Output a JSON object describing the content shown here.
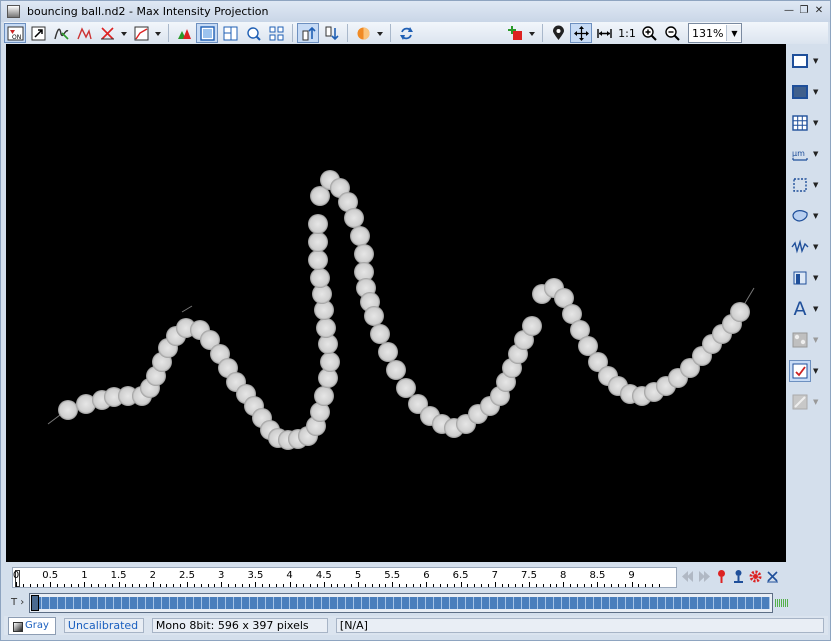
{
  "window": {
    "title": "bouncing ball.nd2 - Max Intensity Projection",
    "controls": [
      "minimize-icon",
      "restore-icon",
      "close-icon"
    ]
  },
  "toolbar": {
    "zoom_value": "131%",
    "one_to_one_label": "1:1",
    "buttons": [
      "lut-on-icon",
      "arrow-select-icon",
      "auto-contrast-icon",
      "histogram-icon",
      "scale-icon",
      "curve-icon",
      "channels-icon",
      "single-view-icon",
      "split-view-icon",
      "zoom-lens-icon",
      "tile-view-icon",
      "up-arrow-icon",
      "down-arrow-icon",
      "color-wheel-icon",
      "refresh-icon",
      "add-object-icon",
      "location-pin-icon",
      "fit-window-icon",
      "fit-width-icon",
      "zoom-in-icon",
      "zoom-out-icon"
    ]
  },
  "sidebar": {
    "items": [
      "rectangle-roi-icon",
      "filled-rectangle-icon",
      "grid-icon",
      "measure-scale-icon",
      "crop-icon",
      "bezier-roi-icon",
      "profile-wave-icon",
      "bookmark-icon",
      "text-annotation-icon",
      "binary-layers-icon",
      "overlay-check-icon",
      "layers-disabled-icon"
    ],
    "text_tool_label": "A"
  },
  "timeline": {
    "ticks": [
      "0",
      "0.5",
      "1",
      "1.5",
      "2",
      "2.5",
      "3",
      "3.5",
      "4",
      "4.5",
      "5",
      "5.5",
      "6",
      "6.5",
      "7",
      "7.5",
      "8",
      "8.5",
      "9"
    ],
    "t_label": "T",
    "nav_icons": [
      "prev-icon",
      "next-icon",
      "red-pin-icon",
      "blue-pin-icon",
      "gear-icon",
      "close-ruler-icon"
    ]
  },
  "status": {
    "lut_tab": "Gray",
    "calibration": "Uncalibrated",
    "image_info": "Mono 8bit: 596 x 397 pixels",
    "value": "[N/A]"
  },
  "colors": {
    "accent": "#1a5fbf",
    "viewport_bg": "#000000",
    "ball": "#d8d8d8",
    "timeline_fill": "#4a7ebc"
  },
  "image": {
    "trajectory_points": [
      [
        62,
        366
      ],
      [
        80,
        360
      ],
      [
        96,
        356
      ],
      [
        108,
        353
      ],
      [
        122,
        352
      ],
      [
        136,
        352
      ],
      [
        144,
        344
      ],
      [
        150,
        332
      ],
      [
        156,
        318
      ],
      [
        162,
        304
      ],
      [
        170,
        292
      ],
      [
        180,
        284
      ],
      [
        194,
        286
      ],
      [
        204,
        296
      ],
      [
        214,
        310
      ],
      [
        222,
        324
      ],
      [
        230,
        338
      ],
      [
        240,
        350
      ],
      [
        248,
        362
      ],
      [
        256,
        374
      ],
      [
        264,
        386
      ],
      [
        272,
        394
      ],
      [
        282,
        396
      ],
      [
        292,
        395
      ],
      [
        302,
        392
      ],
      [
        310,
        382
      ],
      [
        314,
        368
      ],
      [
        318,
        352
      ],
      [
        322,
        334
      ],
      [
        324,
        318
      ],
      [
        322,
        300
      ],
      [
        320,
        284
      ],
      [
        318,
        266
      ],
      [
        316,
        250
      ],
      [
        314,
        234
      ],
      [
        312,
        216
      ],
      [
        312,
        198
      ],
      [
        312,
        180
      ],
      [
        314,
        152
      ],
      [
        324,
        136
      ],
      [
        334,
        144
      ],
      [
        342,
        158
      ],
      [
        348,
        174
      ],
      [
        354,
        192
      ],
      [
        358,
        210
      ],
      [
        358,
        228
      ],
      [
        360,
        244
      ],
      [
        364,
        258
      ],
      [
        368,
        272
      ],
      [
        374,
        290
      ],
      [
        382,
        308
      ],
      [
        390,
        326
      ],
      [
        400,
        344
      ],
      [
        412,
        360
      ],
      [
        424,
        372
      ],
      [
        436,
        380
      ],
      [
        448,
        384
      ],
      [
        460,
        380
      ],
      [
        472,
        370
      ],
      [
        484,
        362
      ],
      [
        494,
        352
      ],
      [
        500,
        338
      ],
      [
        506,
        324
      ],
      [
        512,
        310
      ],
      [
        518,
        296
      ],
      [
        526,
        282
      ],
      [
        536,
        250
      ],
      [
        548,
        244
      ],
      [
        558,
        254
      ],
      [
        566,
        270
      ],
      [
        574,
        286
      ],
      [
        582,
        302
      ],
      [
        592,
        318
      ],
      [
        602,
        332
      ],
      [
        612,
        342
      ],
      [
        624,
        350
      ],
      [
        636,
        352
      ],
      [
        648,
        348
      ],
      [
        660,
        342
      ],
      [
        672,
        334
      ],
      [
        684,
        324
      ],
      [
        696,
        312
      ],
      [
        706,
        300
      ],
      [
        716,
        290
      ],
      [
        726,
        280
      ],
      [
        734,
        268
      ]
    ]
  }
}
